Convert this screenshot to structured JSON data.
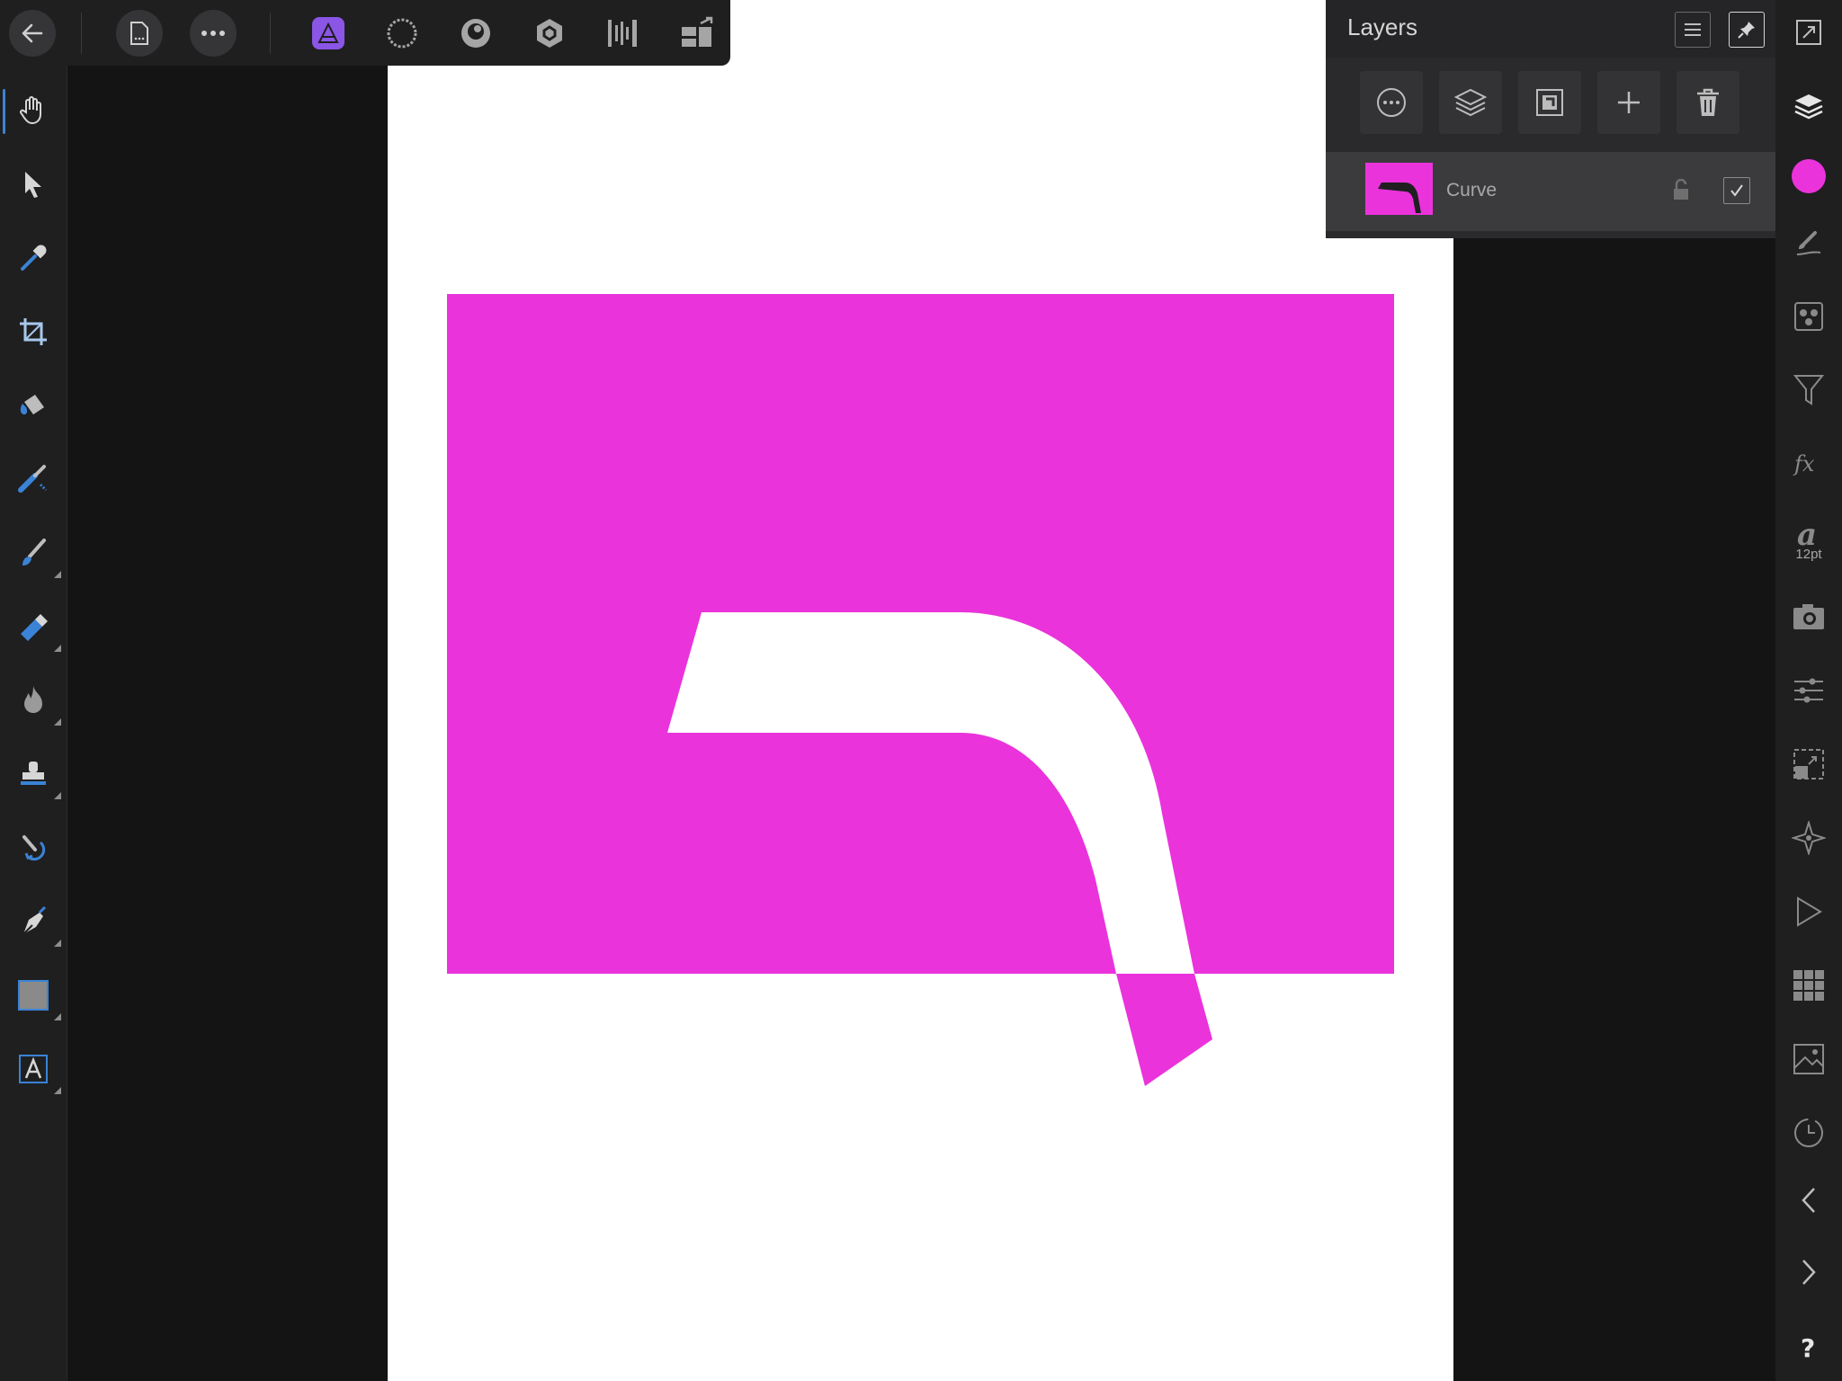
{
  "colors": {
    "accent": "#ea33db",
    "canvas": "#141414",
    "panel": "#1f1f20",
    "selection_blue": "#3a83d6",
    "persona_purple": "#8b55e6"
  },
  "top_toolbar": {
    "buttons": [
      {
        "name": "back-icon"
      },
      {
        "name": "document-icon"
      },
      {
        "name": "more-icon"
      },
      {
        "name": "photo-persona-icon"
      },
      {
        "name": "liquify-persona-icon"
      },
      {
        "name": "develop-persona-icon"
      },
      {
        "name": "tone-mapping-persona-icon"
      },
      {
        "name": "export-persona-icon"
      },
      {
        "name": "publish-icon"
      }
    ]
  },
  "left_toolbar": {
    "active_tool": "view-tool",
    "tools": [
      {
        "name": "view-tool"
      },
      {
        "name": "move-tool"
      },
      {
        "name": "color-picker-tool"
      },
      {
        "name": "crop-tool"
      },
      {
        "name": "flood-fill-tool"
      },
      {
        "name": "selection-brush-tool"
      },
      {
        "name": "paint-brush-tool"
      },
      {
        "name": "erase-brush-tool"
      },
      {
        "name": "dodge-burn-tool"
      },
      {
        "name": "clone-tool"
      },
      {
        "name": "red-eye-tool"
      },
      {
        "name": "pen-tool"
      },
      {
        "name": "rectangle-tool"
      },
      {
        "name": "text-tool"
      }
    ]
  },
  "layers_panel": {
    "title": "Layers",
    "actions": [
      {
        "name": "layer-options-icon"
      },
      {
        "name": "layer-stack-icon"
      },
      {
        "name": "mask-icon"
      },
      {
        "name": "add-layer-icon"
      },
      {
        "name": "delete-layer-icon"
      }
    ],
    "layers": [
      {
        "name": "Curve",
        "locked": false,
        "visible": true,
        "selected": true
      }
    ]
  },
  "studio_bar": {
    "font_size": "12pt",
    "buttons": [
      {
        "name": "fullscreen-icon"
      },
      {
        "name": "layers-icon"
      },
      {
        "name": "color-icon"
      },
      {
        "name": "brushes-icon"
      },
      {
        "name": "channels-icon"
      },
      {
        "name": "filters-icon"
      },
      {
        "name": "fx-icon"
      },
      {
        "name": "text-style-icon"
      },
      {
        "name": "snapshot-icon"
      },
      {
        "name": "adjustments-icon"
      },
      {
        "name": "transform-icon"
      },
      {
        "name": "navigator-icon"
      },
      {
        "name": "macro-icon"
      },
      {
        "name": "swatches-icon"
      },
      {
        "name": "stock-icon"
      },
      {
        "name": "history-icon"
      },
      {
        "name": "undo-icon"
      },
      {
        "name": "redo-icon"
      },
      {
        "name": "help-icon"
      }
    ]
  },
  "document": {
    "shape_color": "#ea33db",
    "layer_name": "Curve"
  }
}
